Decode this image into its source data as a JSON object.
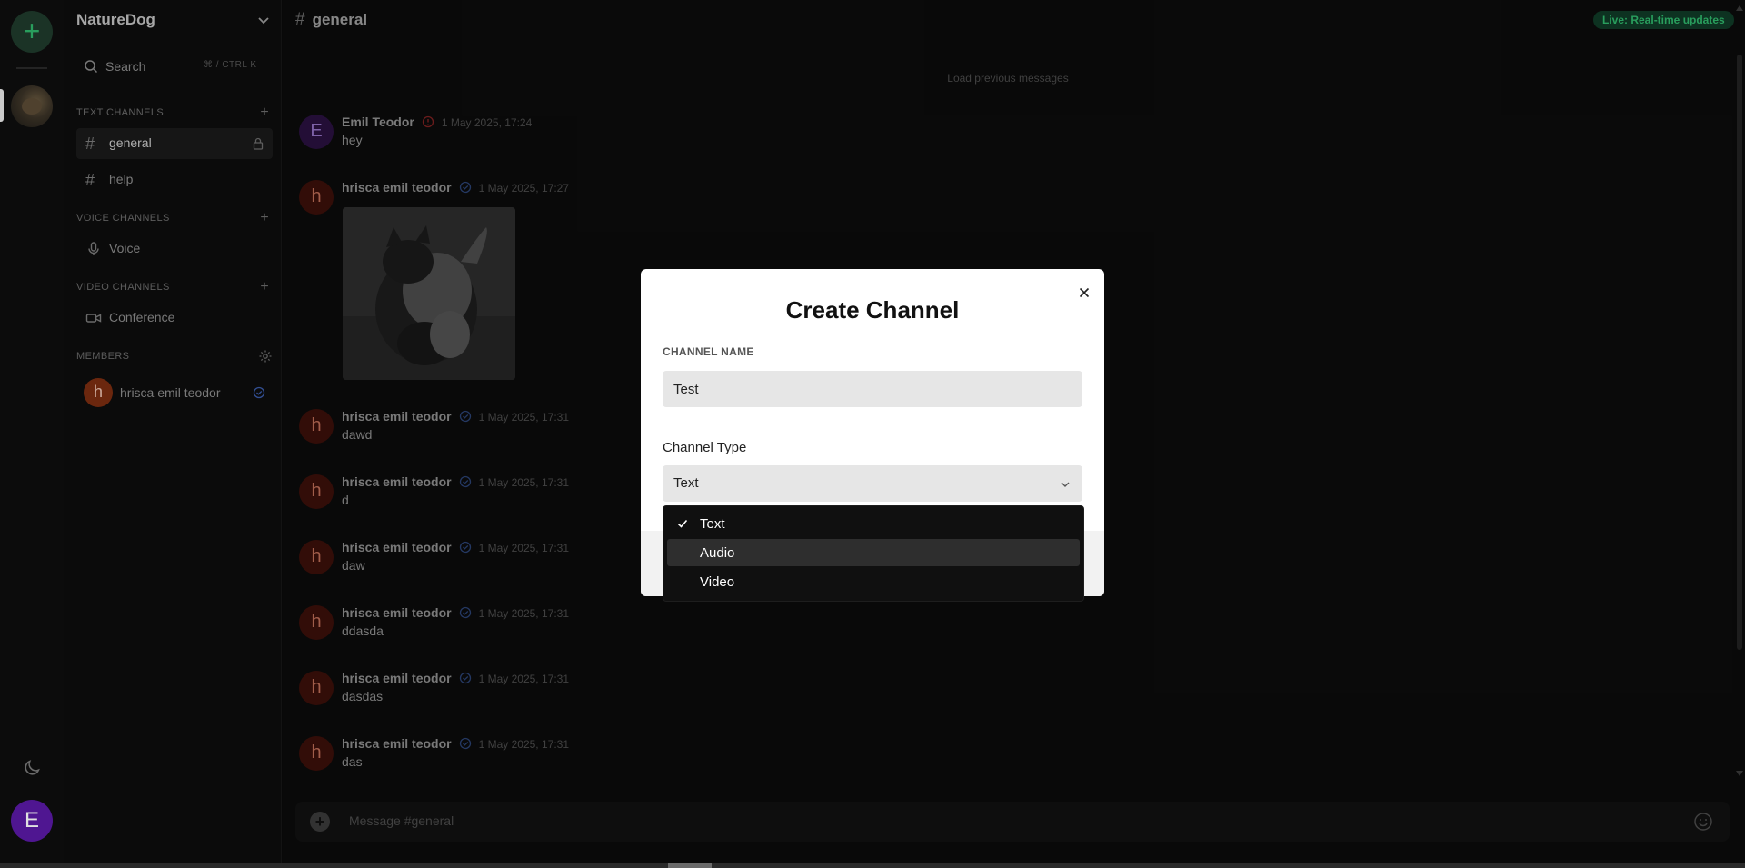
{
  "server": {
    "name": "NatureDog",
    "add_label": "+",
    "user_initial": "E"
  },
  "sidebar": {
    "search_label": "Search",
    "search_shortcut": "⌘ / CTRL K",
    "text_section": "TEXT CHANNELS",
    "voice_section": "VOICE CHANNELS",
    "video_section": "VIDEO CHANNELS",
    "members_section": "MEMBERS",
    "text_channels": [
      {
        "label": "general"
      },
      {
        "label": "help"
      }
    ],
    "voice_channels": [
      {
        "label": "Voice"
      }
    ],
    "video_channels": [
      {
        "label": "Conference"
      }
    ],
    "members": [
      {
        "initial": "h",
        "name": "hrisca emil teodor"
      }
    ]
  },
  "chat": {
    "channel_name": "general",
    "live_badge": "Live: Real-time updates",
    "load_previous": "Load previous messages",
    "composer_placeholder": "Message #general",
    "messages": [
      {
        "initial": "E",
        "author": "Emil Teodor",
        "timestamp": "1 May 2025, 17:24",
        "text": "hey"
      },
      {
        "initial": "h",
        "author": "hrisca emil teodor",
        "timestamp": "1 May 2025, 17:27",
        "text": ""
      },
      {
        "initial": "h",
        "author": "hrisca emil teodor",
        "timestamp": "1 May 2025, 17:31",
        "text": "dawd"
      },
      {
        "initial": "h",
        "author": "hrisca emil teodor",
        "timestamp": "1 May 2025, 17:31",
        "text": "d"
      },
      {
        "initial": "h",
        "author": "hrisca emil teodor",
        "timestamp": "1 May 2025, 17:31",
        "text": "daw"
      },
      {
        "initial": "h",
        "author": "hrisca emil teodor",
        "timestamp": "1 May 2025, 17:31",
        "text": "ddasda"
      },
      {
        "initial": "h",
        "author": "hrisca emil teodor",
        "timestamp": "1 May 2025, 17:31",
        "text": "dasdas"
      },
      {
        "initial": "h",
        "author": "hrisca emil teodor",
        "timestamp": "1 May 2025, 17:31",
        "text": "das"
      }
    ]
  },
  "modal": {
    "title": "Create Channel",
    "name_label": "CHANNEL NAME",
    "name_value": "Test",
    "type_label": "Channel Type",
    "type_value": "Text",
    "options": [
      {
        "label": "Text",
        "selected": true
      },
      {
        "label": "Audio",
        "hovered": true
      },
      {
        "label": "Video"
      }
    ]
  },
  "colors": {
    "accent_green": "#2fb46a",
    "live_badge_bg": "#0f3a26",
    "user_avatar": "#5a1aa6",
    "member_avatar": "#7a2d10",
    "modal_bg": "#ffffff",
    "dropdown_bg": "#101010"
  },
  "icons": [
    "plus-icon",
    "moon-icon",
    "chevron-down-icon",
    "search-icon",
    "hash-icon",
    "lock-icon",
    "microphone-icon",
    "video-camera-icon",
    "gear-icon",
    "verified-badge-icon",
    "alert-badge-icon",
    "close-icon",
    "check-icon",
    "emoji-icon"
  ]
}
